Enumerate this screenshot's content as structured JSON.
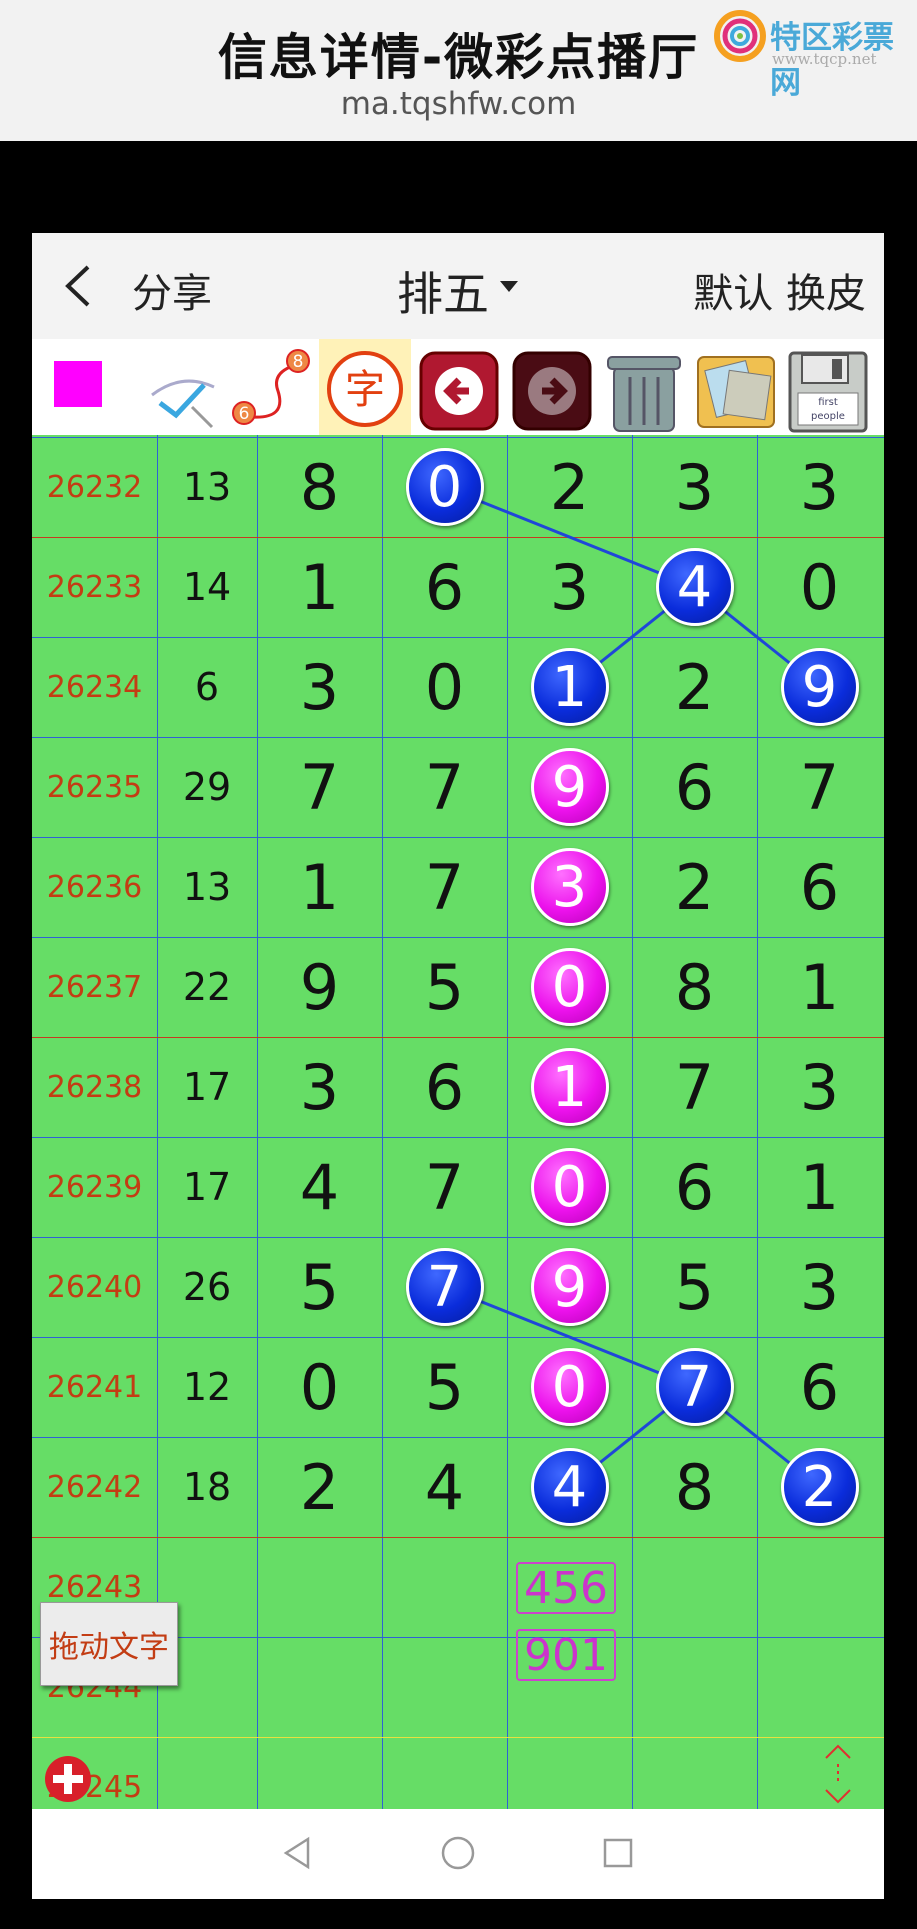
{
  "header": {
    "title": "信息详情-微彩点播厅",
    "url": "ma.tqshfw.com"
  },
  "logo": {
    "name": "特区彩票网",
    "url": "www.tqcp.net"
  },
  "nav": {
    "share": "分享",
    "title": "排五",
    "default": "默认",
    "skin": "换皮"
  },
  "toolbar": {
    "items": [
      "color-swatch",
      "pen-tool",
      "route-tool",
      "text-tool",
      "back-arrow",
      "forward-arrow",
      "trash",
      "photos",
      "save"
    ],
    "route_label_top": "8",
    "route_label_bottom": "6",
    "text_tool_label": "字",
    "save_label_1": "first",
    "save_label_2": "people",
    "swatch_color": "#ff00ff"
  },
  "grid": {
    "rows": [
      {
        "issue": "26232",
        "sum": "13",
        "digits": [
          "8",
          "0",
          "2",
          "3",
          "3"
        ]
      },
      {
        "issue": "26233",
        "sum": "14",
        "digits": [
          "1",
          "6",
          "3",
          "4",
          "0"
        ]
      },
      {
        "issue": "26234",
        "sum": "6",
        "digits": [
          "3",
          "0",
          "1",
          "2",
          "9"
        ]
      },
      {
        "issue": "26235",
        "sum": "29",
        "digits": [
          "7",
          "7",
          "9",
          "6",
          "7"
        ]
      },
      {
        "issue": "26236",
        "sum": "13",
        "digits": [
          "1",
          "7",
          "3",
          "2",
          "6"
        ]
      },
      {
        "issue": "26237",
        "sum": "22",
        "digits": [
          "9",
          "5",
          "0",
          "8",
          "1"
        ]
      },
      {
        "issue": "26238",
        "sum": "17",
        "digits": [
          "3",
          "6",
          "1",
          "7",
          "3"
        ]
      },
      {
        "issue": "26239",
        "sum": "17",
        "digits": [
          "4",
          "7",
          "0",
          "6",
          "1"
        ]
      },
      {
        "issue": "26240",
        "sum": "26",
        "digits": [
          "5",
          "7",
          "9",
          "5",
          "3"
        ]
      },
      {
        "issue": "26241",
        "sum": "12",
        "digits": [
          "0",
          "5",
          "0",
          "7",
          "6"
        ]
      },
      {
        "issue": "26242",
        "sum": "18",
        "digits": [
          "2",
          "4",
          "4",
          "8",
          "2"
        ]
      },
      {
        "issue": "26243",
        "sum": "",
        "digits": [
          "",
          "",
          "",
          "",
          ""
        ]
      },
      {
        "issue": "26244",
        "sum": "",
        "digits": [
          "",
          "",
          "",
          "",
          ""
        ]
      },
      {
        "issue": "26245",
        "sum": "",
        "digits": [
          "",
          "",
          "",
          "",
          ""
        ]
      }
    ],
    "highlights": [
      {
        "row": 0,
        "col": 1,
        "color": "blue"
      },
      {
        "row": 1,
        "col": 3,
        "color": "blue"
      },
      {
        "row": 2,
        "col": 2,
        "color": "blue"
      },
      {
        "row": 2,
        "col": 4,
        "color": "blue"
      },
      {
        "row": 3,
        "col": 2,
        "color": "pink"
      },
      {
        "row": 4,
        "col": 2,
        "color": "pink"
      },
      {
        "row": 5,
        "col": 2,
        "color": "pink"
      },
      {
        "row": 6,
        "col": 2,
        "color": "pink"
      },
      {
        "row": 7,
        "col": 2,
        "color": "pink"
      },
      {
        "row": 8,
        "col": 1,
        "color": "blue"
      },
      {
        "row": 8,
        "col": 2,
        "color": "pink"
      },
      {
        "row": 9,
        "col": 2,
        "color": "pink"
      },
      {
        "row": 9,
        "col": 3,
        "color": "blue"
      },
      {
        "row": 10,
        "col": 2,
        "color": "blue"
      },
      {
        "row": 10,
        "col": 4,
        "color": "blue"
      }
    ],
    "links": [
      [
        [
          0,
          1
        ],
        [
          1,
          3
        ]
      ],
      [
        [
          1,
          3
        ],
        [
          2,
          2
        ]
      ],
      [
        [
          1,
          3
        ],
        [
          2,
          4
        ]
      ],
      [
        [
          8,
          1
        ],
        [
          9,
          3
        ]
      ],
      [
        [
          9,
          3
        ],
        [
          10,
          2
        ]
      ],
      [
        [
          9,
          3
        ],
        [
          10,
          4
        ]
      ]
    ],
    "predictions": [
      "456",
      "901"
    ],
    "colors": {
      "blue_ball": "#0a2cdb",
      "pink_ball": "#ec12ec",
      "grid_bg": "#66dd66",
      "issue_text": "#c33d14"
    }
  },
  "drag_text_button": "拖动文字"
}
